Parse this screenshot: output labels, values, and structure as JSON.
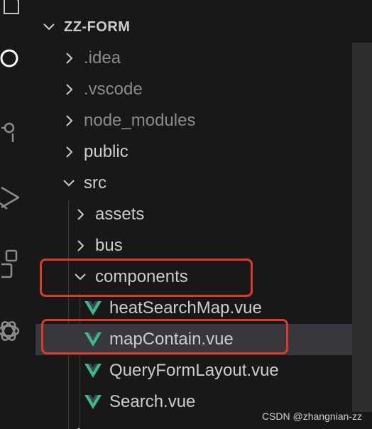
{
  "explorer": {
    "root": {
      "label": "ZZ-FORM",
      "expanded": true
    },
    "items": [
      {
        "label": ".idea",
        "type": "folder",
        "expanded": false,
        "dim": true
      },
      {
        "label": ".vscode",
        "type": "folder",
        "expanded": false,
        "dim": true
      },
      {
        "label": "node_modules",
        "type": "folder",
        "expanded": false,
        "dim": true
      },
      {
        "label": "public",
        "type": "folder",
        "expanded": false,
        "dim": false
      },
      {
        "label": "src",
        "type": "folder",
        "expanded": true,
        "dim": false
      },
      {
        "label": "assets",
        "type": "folder",
        "expanded": false,
        "dim": false
      },
      {
        "label": "bus",
        "type": "folder",
        "expanded": false,
        "dim": false
      },
      {
        "label": "components",
        "type": "folder",
        "expanded": true,
        "dim": false,
        "highlighted": true
      },
      {
        "label": "heatSearchMap.vue",
        "type": "vue-file"
      },
      {
        "label": "mapContain.vue",
        "type": "vue-file",
        "selected": true,
        "highlighted": true
      },
      {
        "label": "QueryFormLayout.vue",
        "type": "vue-file"
      },
      {
        "label": "Search.vue",
        "type": "vue-file"
      }
    ]
  },
  "activity_bar": {
    "icons": [
      "files-icon",
      "search-icon",
      "source-control-icon",
      "run-debug-icon",
      "extensions-icon",
      "openai-icon"
    ]
  },
  "watermark": "CSDN @zhangnian-zz",
  "colors": {
    "background": "#181818",
    "text": "#cccccc",
    "dim_text": "#8b8b8b",
    "selected_row": "#37373d",
    "annotation": "#e0392b",
    "vue_green": "#41b883",
    "vue_dark": "#35495e"
  }
}
